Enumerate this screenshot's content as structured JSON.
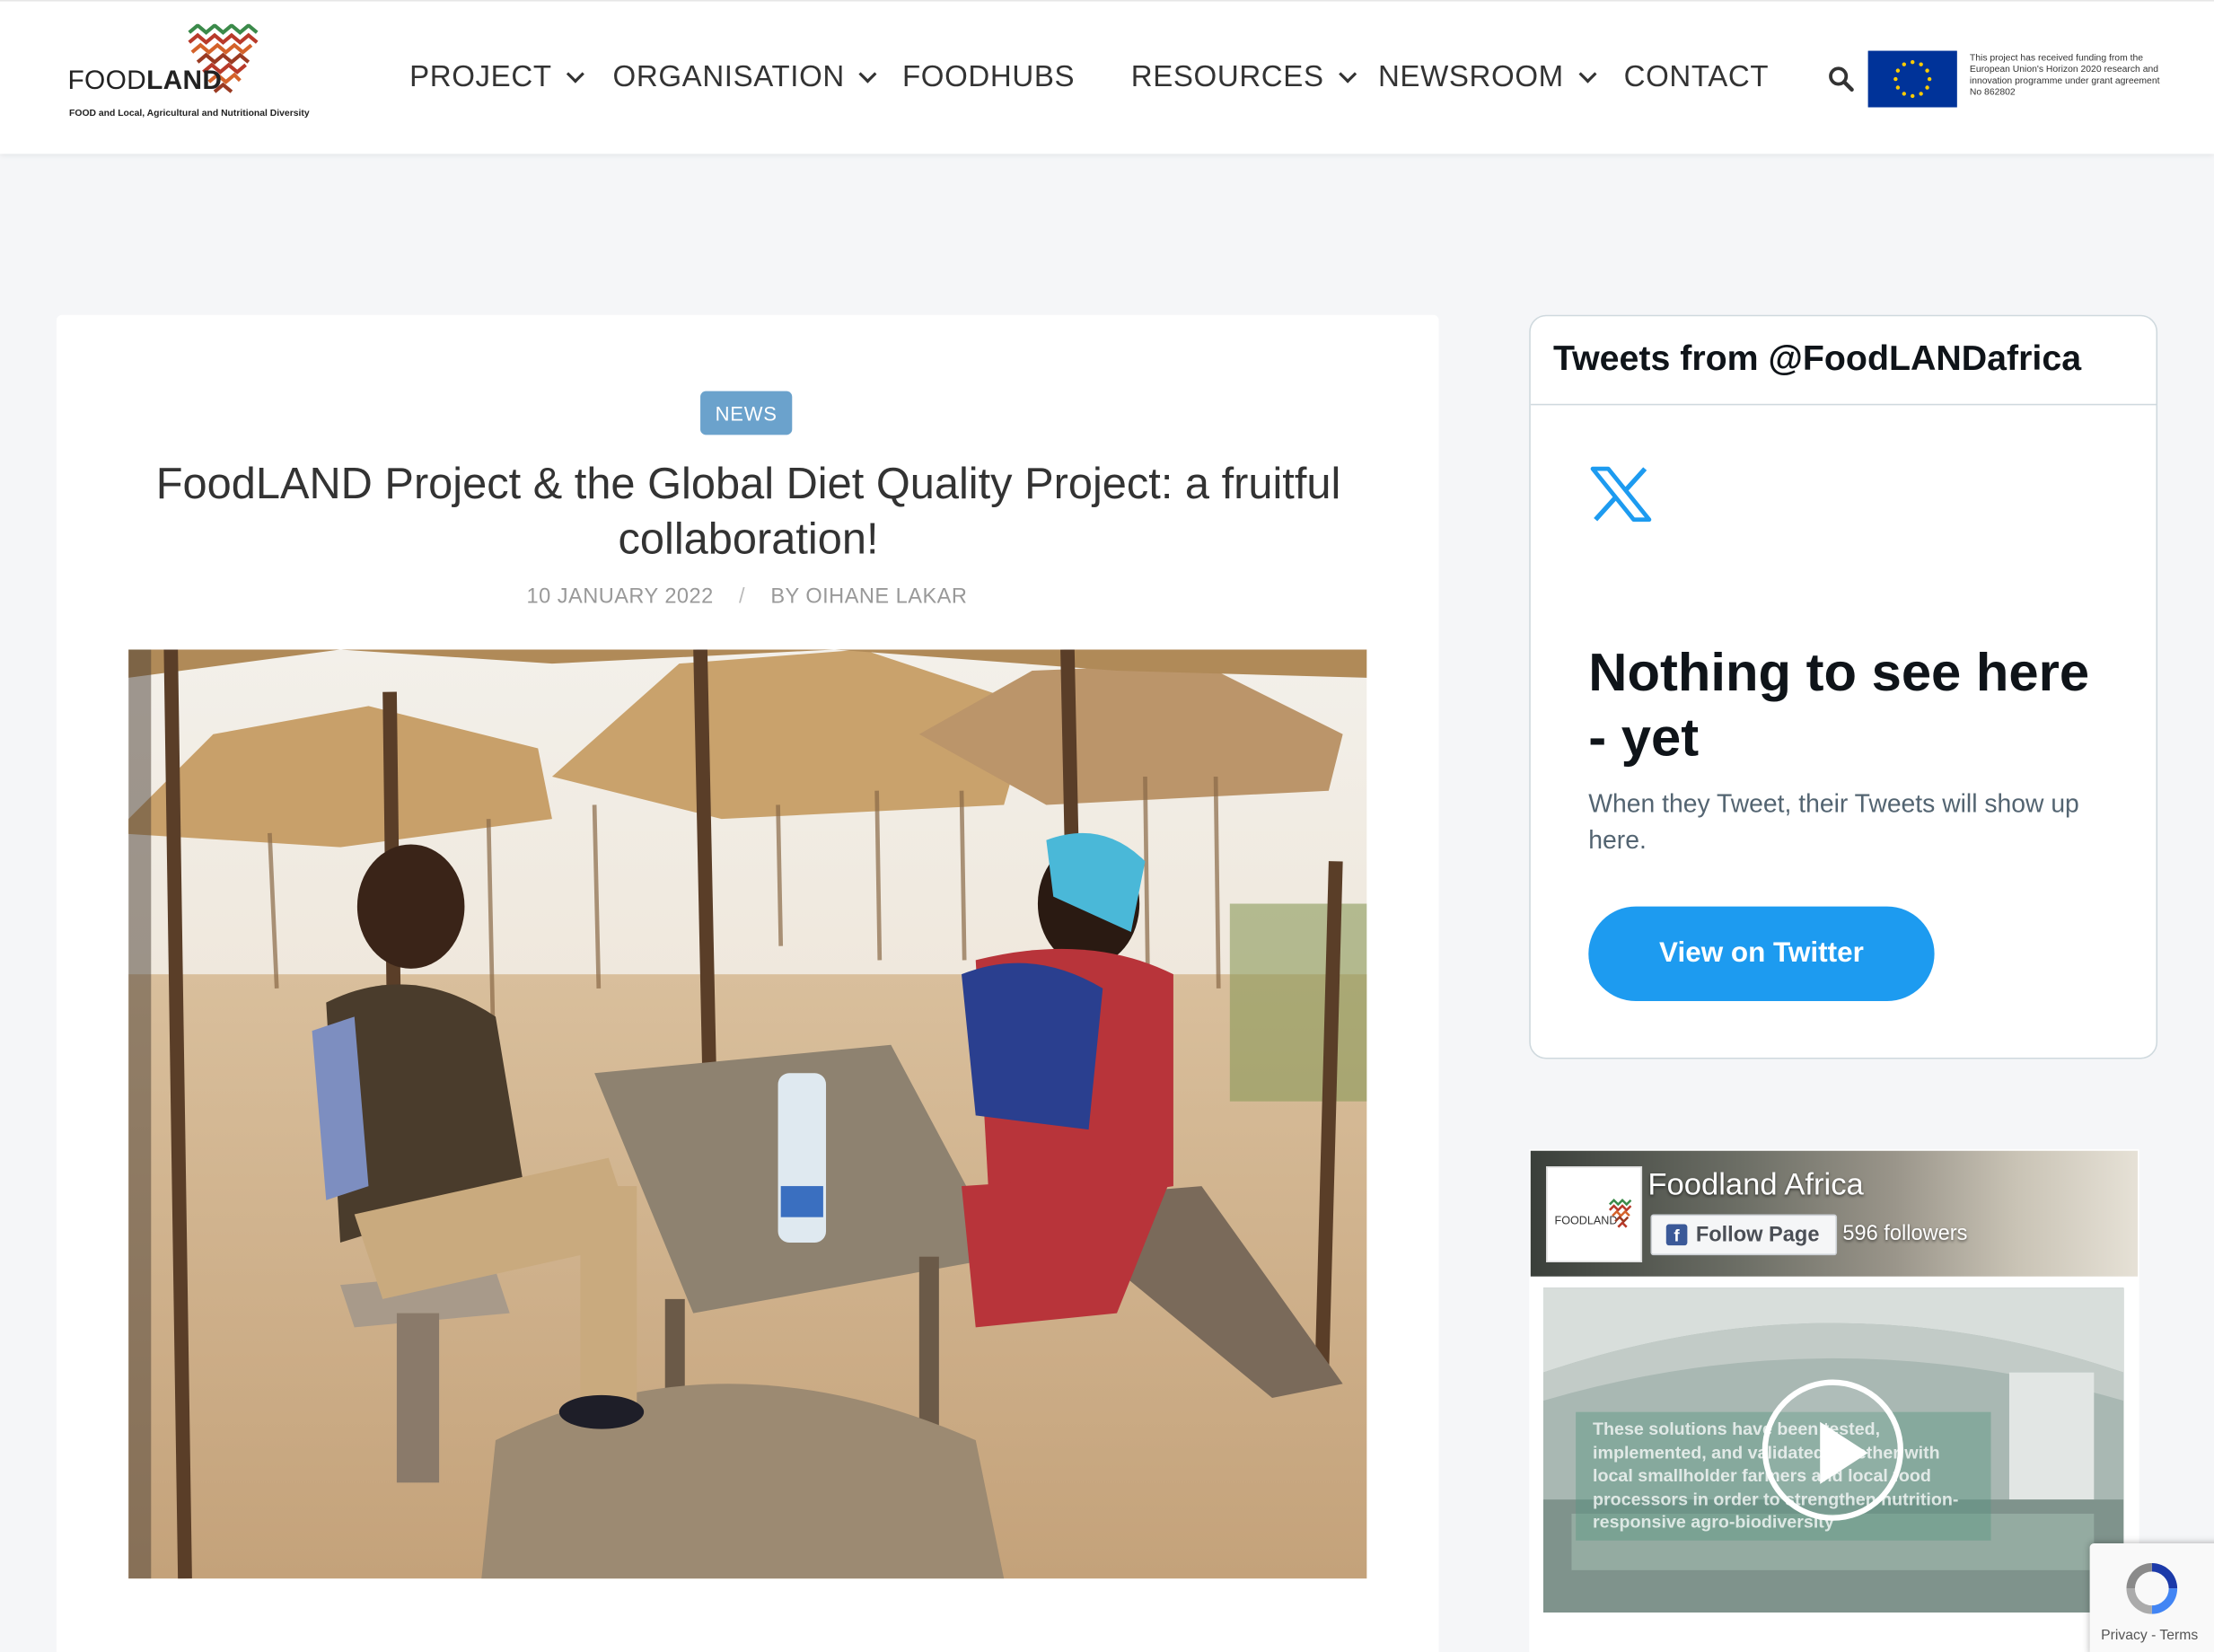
{
  "header": {
    "logo": {
      "word_light": "FOOD",
      "word_bold": "LAND",
      "tagline": "FOOD and Local, Agricultural and Nutritional Diversity"
    },
    "nav": [
      {
        "label": "PROJECT",
        "dropdown": true
      },
      {
        "label": "ORGANISATION",
        "dropdown": true
      },
      {
        "label": "FOODHUBS",
        "dropdown": false
      },
      {
        "label": "RESOURCES",
        "dropdown": true
      },
      {
        "label": "NEWSROOM",
        "dropdown": true
      },
      {
        "label": "CONTACT",
        "dropdown": false
      }
    ],
    "search_icon": "search-icon",
    "eu_funding": "This project has received funding from the European Union's Horizon 2020 research and innovation programme under grant agreement No 862802"
  },
  "article": {
    "category": "NEWS",
    "title": "FoodLAND Project & the Global Diet Quality Project: a fruitful collaboration!",
    "date": "10 JANUARY 2022",
    "separator": "/",
    "author": "BY OIHANE LAKAR"
  },
  "twitter_widget": {
    "title": "Tweets from @FoodLANDafrica",
    "heading": "Nothing to see here - yet",
    "text": "When they Tweet, their Tweets will show up here.",
    "button": "View on Twitter"
  },
  "facebook_widget": {
    "page_name": "Foodland Africa",
    "follow_label": "Follow Page",
    "followers": "596 followers",
    "logo_word": "FOODLAND",
    "video_caption": "These solutions have been tested, implemented, and validated together with local smallholder farmers and local food processors in order to strengthen nutrition-responsive agro-biodiversity"
  },
  "recaptcha": {
    "links": "Privacy - Terms"
  },
  "colors": {
    "badge": "#6ba2cc",
    "twitter_blue": "#1d9bf0",
    "eu_blue": "#003399",
    "page_bg": "#f5f6f8"
  }
}
